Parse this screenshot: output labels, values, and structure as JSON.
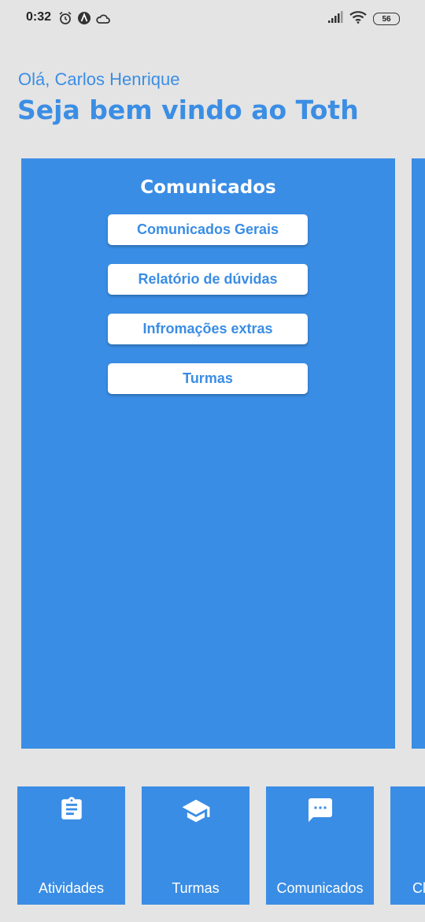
{
  "status_bar": {
    "time": "0:32",
    "battery": "56",
    "left_icons": [
      "alarm-icon",
      "app-a-icon",
      "cloud-icon"
    ],
    "right_icons": [
      "signal-icon",
      "wifi-icon",
      "battery-icon"
    ]
  },
  "header": {
    "greeting": "Olá, Carlos Henrique",
    "welcome": "Seja bem vindo ao Toth"
  },
  "card": {
    "title": "Comunicados",
    "buttons": [
      {
        "label": "Comunicados Gerais"
      },
      {
        "label": "Relatório de dúvidas"
      },
      {
        "label": "Infromações extras"
      },
      {
        "label": "Turmas"
      }
    ]
  },
  "nav": {
    "items": [
      {
        "label": "Atividades",
        "icon": "clipboard-icon"
      },
      {
        "label": "Turmas",
        "icon": "graduation-cap-icon"
      },
      {
        "label": "Comunicados",
        "icon": "chat-bubble-icon"
      },
      {
        "label": "Cl",
        "icon": ""
      }
    ]
  },
  "colors": {
    "background": "#e4e4e4",
    "primary": "#3a8de4",
    "text_on_primary": "#ffffff"
  }
}
